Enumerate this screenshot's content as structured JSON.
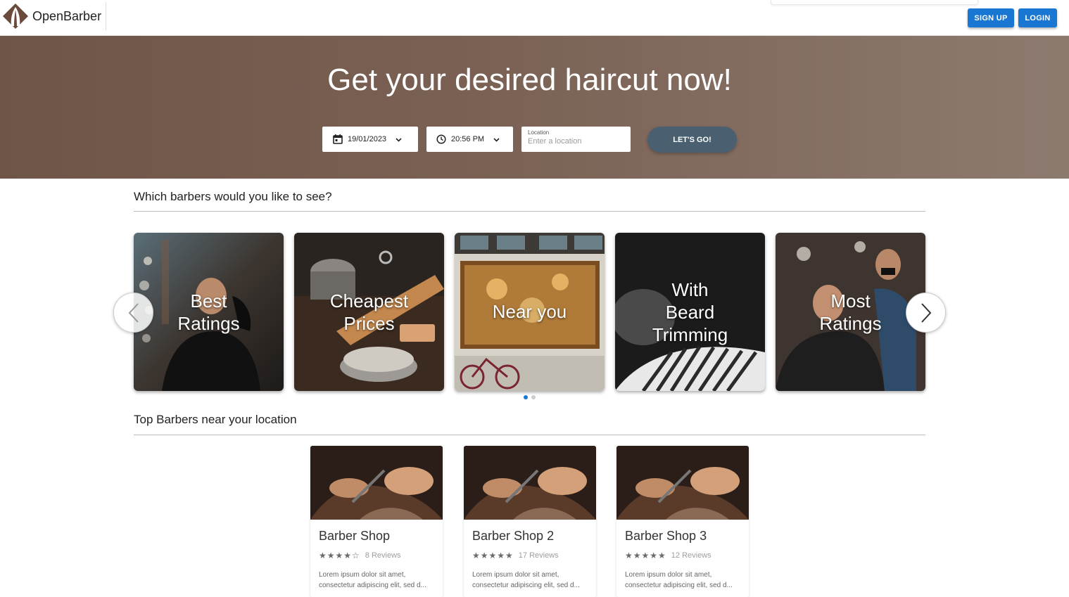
{
  "header": {
    "brand": "OpenBarber",
    "signup_label": "SIGN UP",
    "login_label": "LOGIN"
  },
  "hero": {
    "title": "Get your desired haircut now!",
    "date_value": "19/01/2023",
    "time_value": "20:56 PM",
    "location_label": "Location",
    "location_placeholder": "Enter a location",
    "go_label": "LET'S GO!"
  },
  "categories": {
    "title": "Which barbers would you like to see?",
    "items": [
      {
        "label": "Best Ratings"
      },
      {
        "label": "Cheapest Prices"
      },
      {
        "label": "Near you"
      },
      {
        "label": "With Beard Trimming"
      },
      {
        "label": "Most Ratings"
      }
    ],
    "active_page": 1,
    "page_count": 2
  },
  "top_barbers": {
    "title": "Top Barbers near your location",
    "shops": [
      {
        "name": "Barber Shop",
        "stars": "★★★★☆",
        "rating": 4,
        "reviews": "8 Reviews",
        "description": "Lorem ipsum dolor sit amet, consectetur adipiscing elit, sed d..."
      },
      {
        "name": "Barber Shop 2",
        "stars": "★★★★★",
        "rating": 4.5,
        "reviews": "17 Reviews",
        "description": "Lorem ipsum dolor sit amet, consectetur adipiscing elit, sed d..."
      },
      {
        "name": "Barber Shop 3",
        "stars": "★★★★★",
        "rating": 5,
        "reviews": "12 Reviews",
        "description": "Lorem ipsum dolor sit amet, consectetur adipiscing elit, sed d..."
      }
    ]
  },
  "colors": {
    "primary_blue": "#1976d2",
    "hero_brown": "#7a6154",
    "go_button": "#4a6070"
  }
}
